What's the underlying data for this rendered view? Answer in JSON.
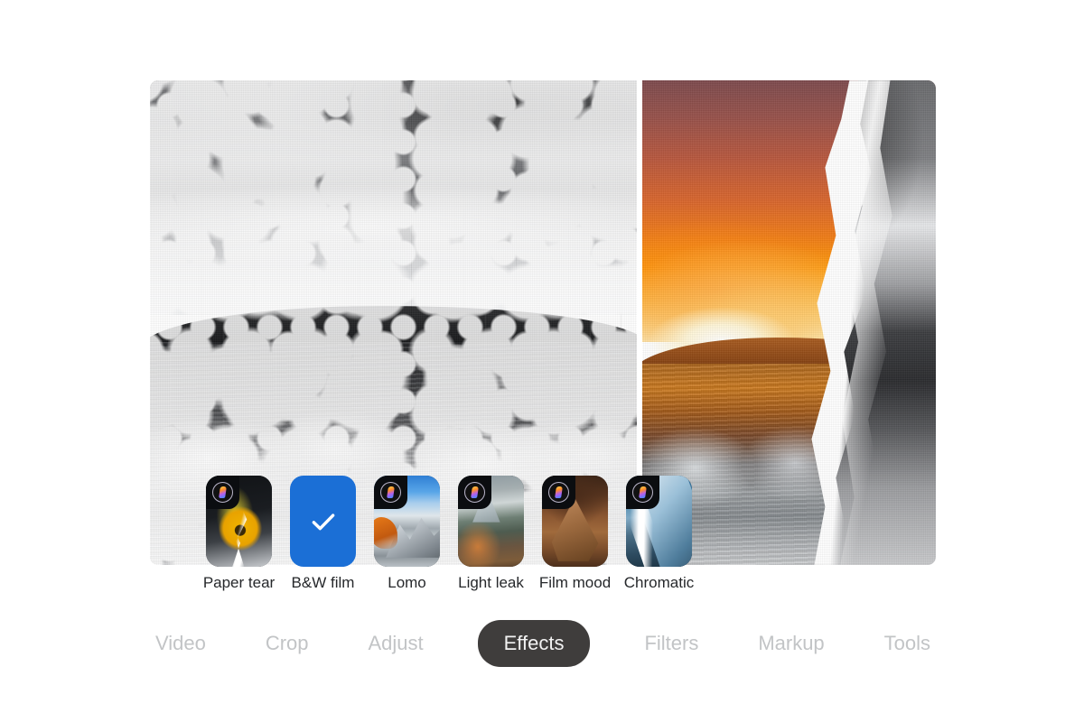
{
  "app": {
    "background_color": "#ffffff",
    "accent_color": "#1b6fd6",
    "active_tab_bg": "#3f3d3c",
    "inactive_tab_color": "#c2c4c6",
    "label_color": "#26282b"
  },
  "preview": {
    "name": "photo-preview",
    "left_pane_description": "Black and white film version of a seascape at sunset with dust and scratch speckles",
    "right_pane_description": "Color sunset seascape with a white torn-paper edge revealing a black and white strip"
  },
  "effects": {
    "selected": "B&W film",
    "check_icon": "check-icon",
    "badge_icon": "pro-effect-badge-icon",
    "items": [
      {
        "label": "Paper tear",
        "art": "art-papertear",
        "selected": false,
        "badge": true
      },
      {
        "label": "B&W film",
        "art": "",
        "selected": true,
        "badge": false
      },
      {
        "label": "Lomo",
        "art": "art-lomo",
        "selected": false,
        "badge": true
      },
      {
        "label": "Light leak",
        "art": "art-lightleak",
        "selected": false,
        "badge": true
      },
      {
        "label": "Film mood",
        "art": "art-filmmood",
        "selected": false,
        "badge": true
      },
      {
        "label": "Chromatic",
        "art": "art-chromatic",
        "selected": false,
        "badge": true
      }
    ]
  },
  "tabs": {
    "active": "Effects",
    "items": [
      {
        "label": "Video",
        "active": false
      },
      {
        "label": "Crop",
        "active": false
      },
      {
        "label": "Adjust",
        "active": false
      },
      {
        "label": "Effects",
        "active": true
      },
      {
        "label": "Filters",
        "active": false
      },
      {
        "label": "Markup",
        "active": false
      },
      {
        "label": "Tools",
        "active": false
      }
    ]
  }
}
